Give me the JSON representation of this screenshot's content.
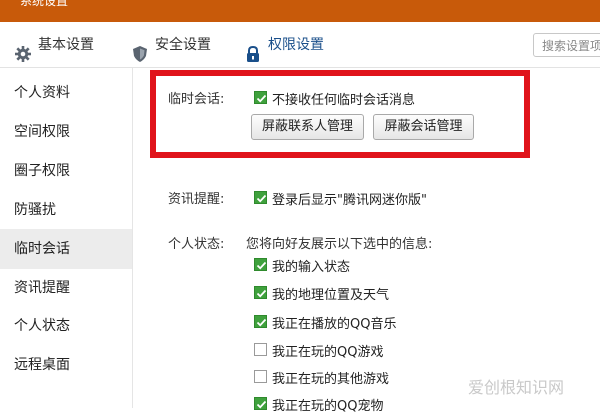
{
  "window": {
    "title": "系统设置"
  },
  "tabs": [
    {
      "label": "基本设置",
      "icon": "gear-icon"
    },
    {
      "label": "安全设置",
      "icon": "shield-icon"
    },
    {
      "label": "权限设置",
      "icon": "lock-icon",
      "active": true
    }
  ],
  "search": {
    "placeholder": "搜索设置项"
  },
  "sidebar": {
    "items": [
      {
        "label": "个人资料"
      },
      {
        "label": "空间权限"
      },
      {
        "label": "圈子权限"
      },
      {
        "label": "防骚扰"
      },
      {
        "label": "临时会话",
        "active": true
      },
      {
        "label": "资讯提醒"
      },
      {
        "label": "个人状态"
      },
      {
        "label": "远程桌面"
      }
    ]
  },
  "temp_chat": {
    "label": "临时会话:",
    "option": {
      "label": "不接收任何临时会话消息",
      "checked": true
    },
    "buttons": [
      "屏蔽联系人管理",
      "屏蔽会话管理"
    ]
  },
  "news": {
    "label": "资讯提醒:",
    "option": {
      "label": "登录后显示\"腾讯网迷你版\"",
      "checked": true
    }
  },
  "status": {
    "label": "个人状态:",
    "intro": "您将向好友展示以下选中的信息:",
    "options": [
      {
        "label": "我的输入状态",
        "checked": true
      },
      {
        "label": "我的地理位置及天气",
        "checked": true
      },
      {
        "label": "我正在播放的QQ音乐",
        "checked": true
      },
      {
        "label": "我正在玩的QQ游戏",
        "checked": false
      },
      {
        "label": "我正在玩的其他游戏",
        "checked": false
      },
      {
        "label": "我正在玩的QQ宠物",
        "checked": true
      }
    ]
  },
  "colors": {
    "highlight": "#e0141b",
    "check": "#3fa13d",
    "titlebar": "#c85a0a",
    "active_tab": "#1a4f8a"
  },
  "watermark": "爱创根知识网"
}
